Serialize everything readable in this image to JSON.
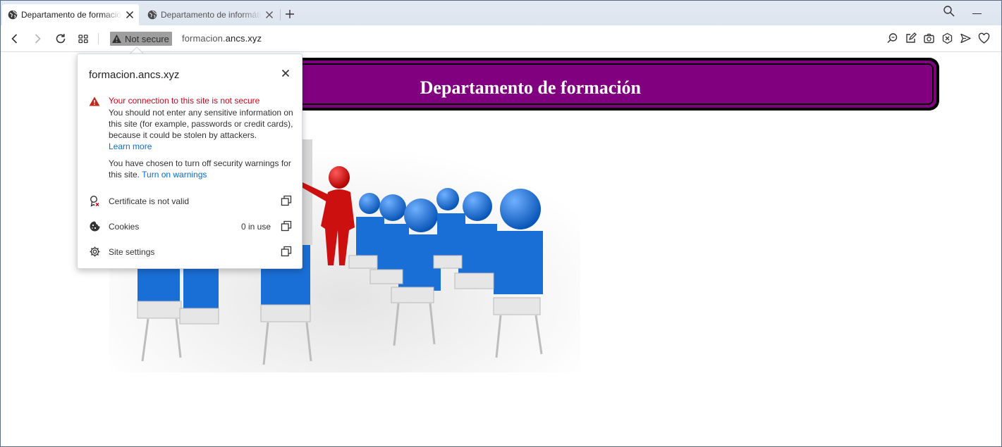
{
  "tabs": [
    {
      "title": "Departamento de formación",
      "icon": "globe-icon",
      "active": true
    },
    {
      "title": "Departamento de informática",
      "icon": "globe-icon",
      "active": false
    }
  ],
  "toolbar": {
    "security_badge": "Not secure",
    "url_prefix": "formacion.",
    "url_host": "ancs.xyz"
  },
  "page": {
    "banner_text": "Departamento de formación",
    "banner_color": "#800080"
  },
  "popup": {
    "host": "formacion.ancs.xyz",
    "warning_title": "Your connection to this site is not secure",
    "warning_body": "You should not enter any sensitive information on this site (for example, passwords or credit cards), because it could be stolen by attackers.",
    "learn_more": "Learn more",
    "notice_body": "You have chosen to turn off security warnings for this site.",
    "turn_on_warnings": "Turn on warnings",
    "rows": [
      {
        "label": "Certificate is not valid",
        "value": "",
        "icon": "certificate-icon"
      },
      {
        "label": "Cookies",
        "value": "0 in use",
        "icon": "cookie-icon"
      },
      {
        "label": "Site settings",
        "value": "",
        "icon": "gear-icon"
      }
    ],
    "warning_color": "#d0021b",
    "link_color": "#0b6bc7"
  }
}
